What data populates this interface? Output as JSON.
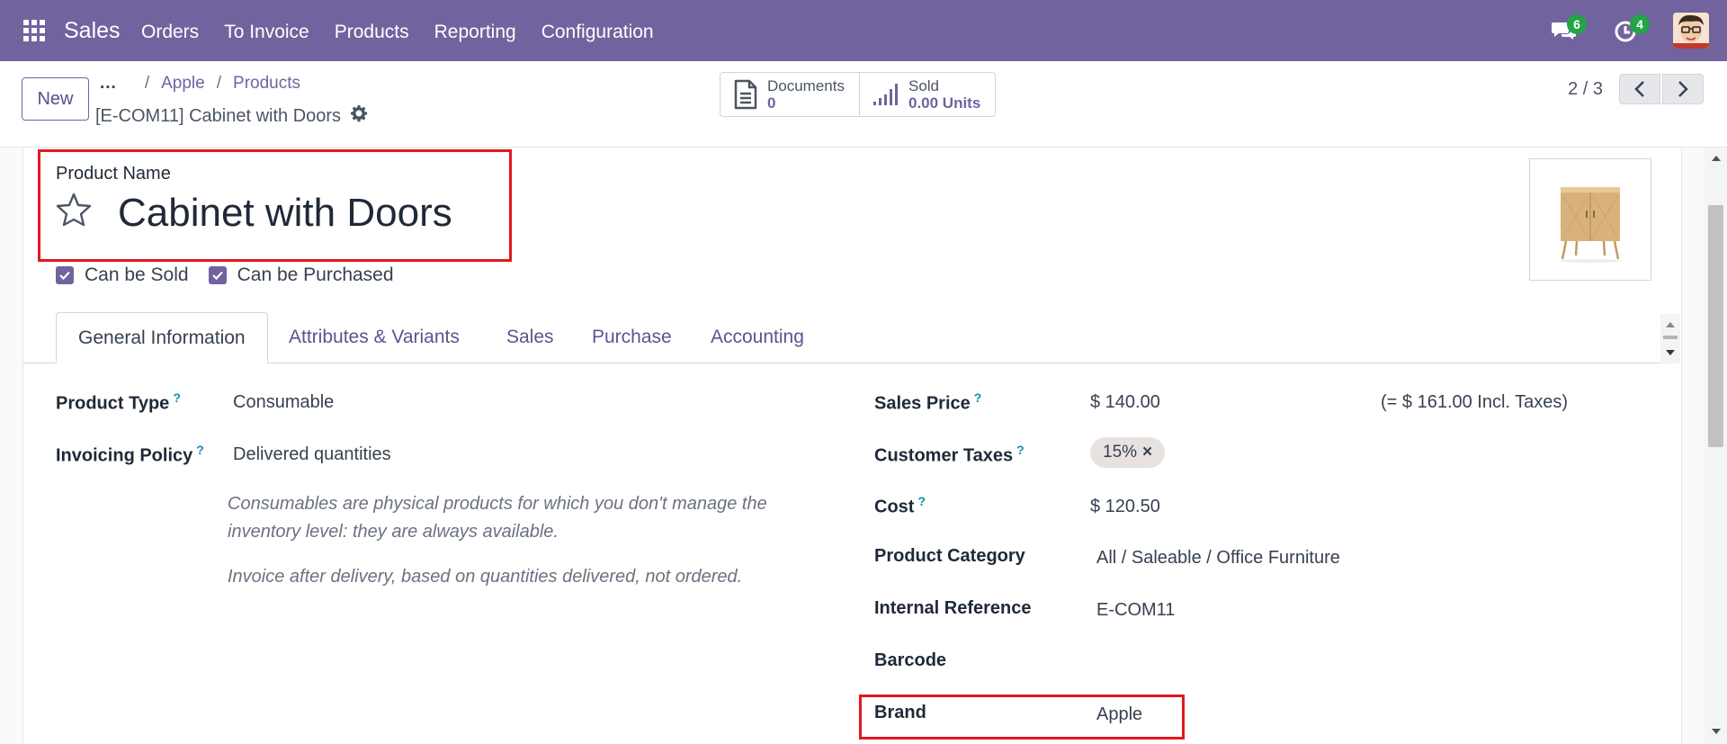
{
  "topbar": {
    "brand": "Sales",
    "menu": [
      "Orders",
      "To Invoice",
      "Products",
      "Reporting",
      "Configuration"
    ],
    "messages_count": "6",
    "activities_count": "4",
    "badge_color": "#22a447",
    "bar_color": "#71639e"
  },
  "control": {
    "new_label": "New",
    "breadcrumb": {
      "ellipsis": "...",
      "items": [
        "Apple",
        "Products"
      ]
    },
    "record_title": "[E-COM11] Cabinet with Doors",
    "smart_buttons": [
      {
        "icon": "document-icon",
        "label": "Documents",
        "value": "0"
      },
      {
        "icon": "signal-bars-icon",
        "label": "Sold",
        "value": "0.00 Units"
      }
    ],
    "pager": "2 / 3"
  },
  "product": {
    "name_label": "Product Name",
    "name": "Cabinet with Doors",
    "can_be_sold": "Can be Sold",
    "can_be_purchased": "Can be Purchased"
  },
  "tabs": [
    "General Information",
    "Attributes & Variants",
    "Sales",
    "Purchase",
    "Accounting"
  ],
  "form": {
    "left": {
      "product_type_label": "Product Type",
      "product_type": "Consumable",
      "invoicing_policy_label": "Invoicing Policy",
      "invoicing_policy": "Delivered quantities",
      "help_consumable": "Consumables are physical products for which you don't manage the inventory level: they are always available.",
      "help_invoice": "Invoice after delivery, based on quantities delivered, not ordered."
    },
    "right": {
      "sales_price_label": "Sales Price",
      "sales_price": "$ 140.00",
      "incl_taxes": "(= $ 161.00 Incl. Taxes)",
      "customer_taxes_label": "Customer Taxes",
      "customer_tax_tag": "15%",
      "cost_label": "Cost",
      "cost": "$ 120.50",
      "category_label": "Product Category",
      "category": "All / Saleable / Office Furniture",
      "internal_ref_label": "Internal Reference",
      "internal_ref": "E-COM11",
      "barcode_label": "Barcode",
      "brand_label": "Brand",
      "brand": "Apple"
    },
    "help_mark": "?"
  },
  "highlight_color": "#e0191f"
}
